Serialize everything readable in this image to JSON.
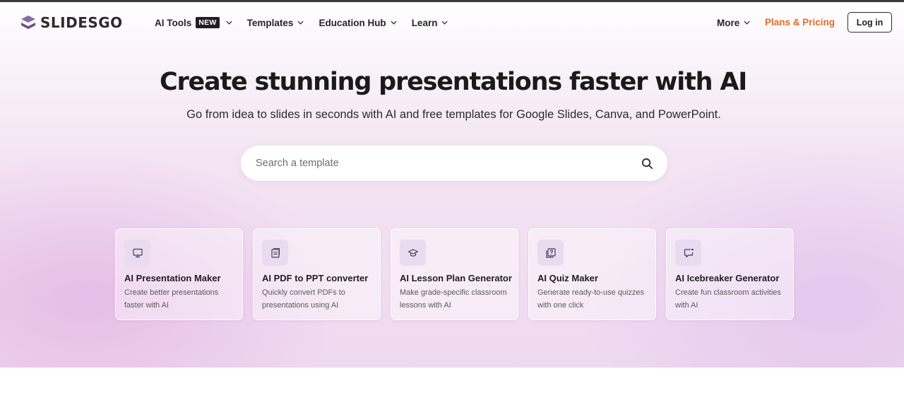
{
  "header": {
    "logo_text": "SLIDESGO",
    "nav": [
      {
        "label": "AI Tools",
        "badge": "NEW"
      },
      {
        "label": "Templates"
      },
      {
        "label": "Education Hub"
      },
      {
        "label": "Learn"
      }
    ],
    "more_label": "More",
    "plans_label": "Plans & Pricing",
    "login_label": "Log in"
  },
  "hero": {
    "title": "Create stunning presentations faster with AI",
    "subtitle": "Go from idea to slides in seconds with AI and free templates for Google Slides, Canva, and PowerPoint."
  },
  "search": {
    "placeholder": "Search a template",
    "icon": "search-icon"
  },
  "cards": [
    {
      "icon": "presentation-icon",
      "title": "AI Presentation Maker",
      "description": "Create better presentations faster with AI"
    },
    {
      "icon": "pdf-convert-icon",
      "title": "AI PDF to PPT converter",
      "description": "Quickly convert PDFs to presentations using AI"
    },
    {
      "icon": "graduation-cap-icon",
      "title": "AI Lesson Plan Generator",
      "description": "Make grade-specific classroom lessons with AI"
    },
    {
      "icon": "quiz-icon",
      "title": "AI Quiz Maker",
      "description": "Generate ready-to-use quizzes with one click"
    },
    {
      "icon": "chat-icon",
      "title": "AI Icebreaker Generator",
      "description": "Create fun classroom activities with AI"
    }
  ],
  "colors": {
    "brand_purple": "#7b5a96",
    "accent_orange": "#e36c29",
    "card_icon_bg": "#eadcf0",
    "hero_gradient": "#efd9f0"
  }
}
